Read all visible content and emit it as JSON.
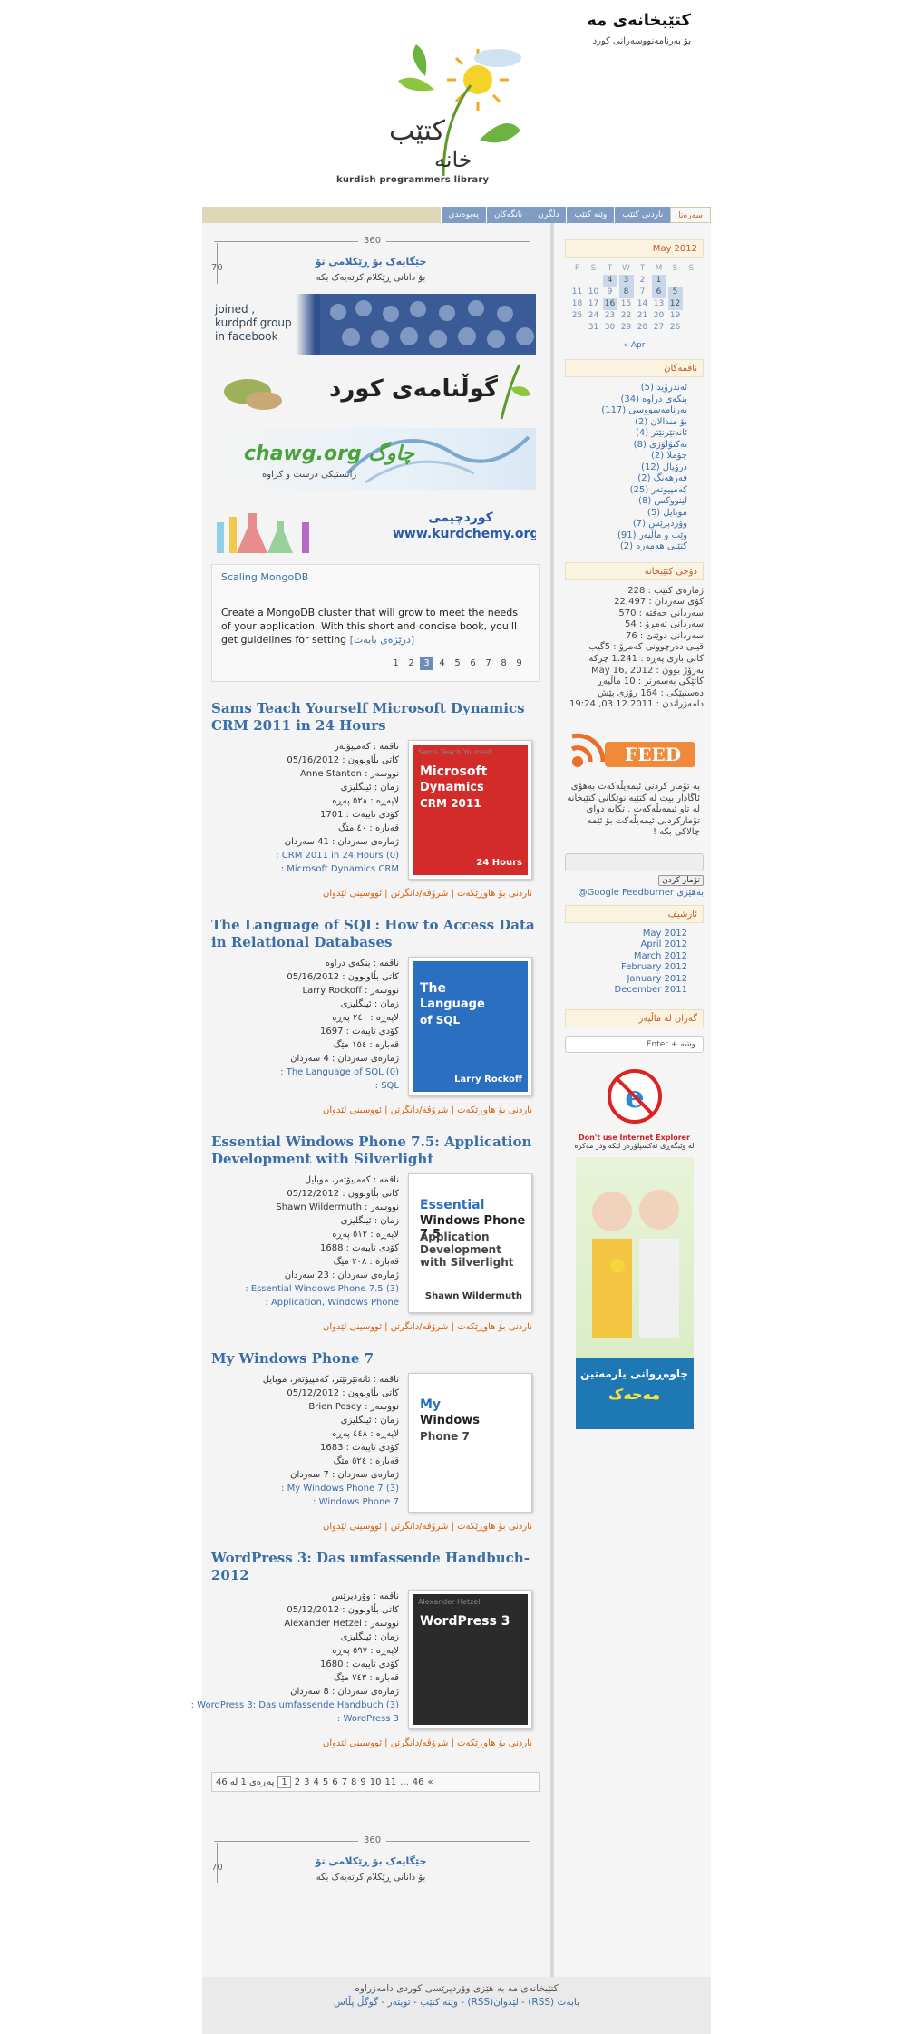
{
  "header": {
    "site_title": "کتێبخانەی مە",
    "tagline": "بۆ بەرنامەنووسەرانی کورد",
    "logo_caption": "kurdish programmers library"
  },
  "nav": [
    "سەرەتا",
    "ناردنی کتێب",
    "وێنە کتێب",
    "دڵگرن",
    "ناتگەکان",
    "پەیوەندی"
  ],
  "ad": {
    "width": "360",
    "height": "70",
    "title": "جێگایەک بۆ ڕێکلامی تۆ",
    "subtitle": "بۆ دانانی ڕێکلام کرتەیەک بکە"
  },
  "banners": {
    "facebook": "joined , kurdpdf group in facebook",
    "gul": "گوڵنامەی کورد",
    "chawg": "chawg.org چاوگ",
    "chawg_sub": "زانستیکی درست و کراوە",
    "kurdchemy": "کوردچیمی www.kurdchemy.org"
  },
  "featured": {
    "title": "Scaling MongoDB",
    "text": "Create a MongoDB cluster that will grow to meet the needs of your application. With this short and concise book, you'll get guidelines for setting",
    "more": "[درێژەی بابەت]",
    "pages": [
      "1",
      "2",
      "3",
      "4",
      "5",
      "6",
      "7",
      "8",
      "9"
    ],
    "current": "3"
  },
  "posts": [
    {
      "title": "Sams Teach Yourself Microsoft Dynamics CRM 2011 in 24 Hours",
      "meta": [
        "ناقمە : کەمپیۆتەر",
        "کاتی بڵاوبوون : 05/16/2012",
        "نووسەر : Anne Stanton",
        "زمان : ئینگلیزی",
        "لاپەڕە : ٥٢٨ پەڕە",
        "کۆدی تایبەت : 1701",
        "قەبارە : ٤٠ مێگ",
        "ژمارەی سەردان : 41 سەردان"
      ],
      "links": [
        "CRM 2011 in 24 Hours (0) :",
        "Microsoft Dynamics CRM :"
      ],
      "footer": "ناردنی بۆ هاوڕێکەت | شرۆڤە/دانگرتن | ئووسینی لێدوان",
      "cover": {
        "brand": "Sams Teach Yourself",
        "line1": "Microsoft",
        "line2": "Dynamics",
        "line3": "CRM 2011",
        "accent": "24 Hours",
        "color": "#d32a2a"
      }
    },
    {
      "title": "The Language of SQL: How to Access Data in Relational Databases",
      "meta": [
        "ناقمە : بنکەی دراوە",
        "کاتی بڵاوبوون : 05/16/2012",
        "نووسەر : Larry Rockoff",
        "زمان : ئینگلیزی",
        "لاپەڕە : ٢٤٠ پەڕە",
        "کۆدی تایبەت : 1697",
        "قەبارە : ١٥٤ مێگ",
        "ژمارەی سەردان : 4 سەردان"
      ],
      "links": [
        "The Language of SQL (0) :",
        "SQL :"
      ],
      "footer": "ناردنی بۆ هاوڕێکەت | شرۆڤە/دانگرتن | ئووسینی لێدوان",
      "cover": {
        "brand": "",
        "line1": "The",
        "line2": "Language",
        "line3": "of SQL",
        "accent": "Larry Rockoff",
        "color": "#2a6fc0"
      }
    },
    {
      "title": "Essential Windows Phone 7.5: Application Development with Silverlight",
      "meta": [
        "ناقمە : کەمپیۆتەر، موبایل",
        "کاتی بڵاوبوون : 05/12/2012",
        "نووسەر : Shawn Wildermuth",
        "زمان : ئینگلیزی",
        "لاپەڕە : ٥١٢ پەڕە",
        "کۆدی تایبەت : 1688",
        "قەبارە : ٢٠٨ مێگ",
        "ژمارەی سەردان : 23 سەردان"
      ],
      "links": [
        "Essential Windows Phone 7.5 (3) :",
        "Application, Windows Phone :"
      ],
      "footer": "ناردنی بۆ هاوڕێکەت | شرۆڤە/دانگرتن | ئووسینی لێدوان",
      "cover": {
        "brand": "",
        "line1": "Essential",
        "line2": "Windows Phone 7.5",
        "line3": "Application Development with Silverlight",
        "accent": "Shawn Wildermuth",
        "color": "#ffffff"
      }
    },
    {
      "title": "My Windows Phone 7",
      "meta": [
        "ناقمە : ئانەتێرنێتر، کەمپیۆتەر، موبایل",
        "کاتی بڵاوبوون : 05/12/2012",
        "نووسەر : Brien Posey",
        "زمان : ئینگلیزی",
        "لاپەڕە : ٤٤٨ پەڕە",
        "کۆدی تایبەت : 1683",
        "قەبارە : ٥٢٤ مێگ",
        "ژمارەی سەردان : 7 سەردان"
      ],
      "links": [
        "My Windows Phone 7 (3) :",
        "Windows Phone 7 :"
      ],
      "footer": "ناردنی بۆ هاوڕێکەت | شرۆڤە/دانگرتن | ئووسینی لێدوان",
      "cover": {
        "brand": "",
        "line1": "My",
        "line2": "Windows",
        "line3": "Phone 7",
        "accent": "",
        "color": "#ffffff"
      }
    },
    {
      "title": "WordPress 3: Das umfassende Handbuch-2012",
      "meta": [
        "ناقمە : وۆردپرێس",
        "کاتی بڵاوبوون : 05/12/2012",
        "نووسەر : Alexander Hetzel",
        "زمان : ئینگلیزی",
        "لاپەڕە : ٥٩٧ پەڕە",
        "کۆدی تایبەت : 1680",
        "قەبارە : ٧٤٣ مێگ",
        "ژمارەی سەردان : 8 سەردان"
      ],
      "links": [
        "WordPress 3: Das umfassende Handbuch (3) :",
        "WordPress 3 :"
      ],
      "footer": "ناردنی بۆ هاوڕێکەت | شرۆڤە/دانگرتن | ئووسینی لێدوان",
      "cover": {
        "brand": "Alexander Hetzel",
        "line1": "WordPress 3",
        "line2": "",
        "line3": "",
        "accent": "",
        "color": "#2b2b2b"
      }
    }
  ],
  "pager": {
    "label": "پەڕەی 1 لە 46",
    "items": [
      "1",
      "2",
      "3",
      "4",
      "5",
      "6",
      "7",
      "8",
      "9",
      "10",
      "11",
      "...",
      "46",
      "»"
    ],
    "current": "1"
  },
  "ad_bottom": {
    "width": "360",
    "height": "70",
    "title": "جێگایەک بۆ ڕێکلامی تۆ",
    "subtitle": "بۆ دانانی ڕێکلام کرتەیەک بکە"
  },
  "sidebar": {
    "calendar_title": "May 2012",
    "weekdays": [
      "F",
      "S",
      "T",
      "W",
      "T",
      "M",
      "S",
      "S"
    ],
    "weeks": [
      [
        "",
        "",
        "4",
        "3",
        "2",
        "1",
        "",
        ""
      ],
      [
        "11",
        "10",
        "9",
        "8",
        "7",
        "6",
        "5",
        ""
      ],
      [
        "18",
        "17",
        "16",
        "15",
        "14",
        "13",
        "12",
        ""
      ],
      [
        "25",
        "24",
        "23",
        "22",
        "21",
        "20",
        "19",
        ""
      ],
      [
        "",
        "31",
        "30",
        "29",
        "28",
        "27",
        "26",
        ""
      ]
    ],
    "calendar_nav": "Apr »",
    "categories_title": "ناقمەکان",
    "categories": [
      "ئەندرۆید (5)",
      "بنکەی دراوە (34)",
      "بەرنامەسووسی (117)",
      "بۆ مندالان (2)",
      "ئانەتێرنێتر (4)",
      "تەکنۆلۆژی (8)",
      "جۆملا (2)",
      "درۆپال (12)",
      "فەرهەنگ (2)",
      "کەمپیوتەر (25)",
      "لینووکس (8)",
      "موبایل (5)",
      "وۆردپرێس (7)",
      "وێب و ماڵپەر (91)",
      "کتێبی هەمەرە (2)"
    ],
    "stats_title": "دۆخی کتێبخانە",
    "stats": [
      "ژمارەی کتێب : 228",
      "کۆی سەردان : 22,497",
      "سەردانی حەفتە : 570",
      "سەردانی ئەمڕۆ : 54",
      "سەردانی دوێنێ : 76",
      "قیبی دەرچوونی کەمرۆ : 5گیب",
      "کاتی باری پەڕە : 1.241 چرکە",
      "بەرۆژ بوون : May 16, 2012",
      "کاتێکی بەسەرنر : 10 ماڵپەڕ",
      "دەستپێکی : 164 رۆژی پێش",
      "دامەزراندن : 03.12.2011, 19:24"
    ],
    "feed_label": "FEED",
    "feed_text": "بە تۆمار کردنی ئیمەیڵەکەت بەهۆی ئاگادار بیت لە کتێبە نوێکانی کتێبخانە لە تاو ئیمەیڵەکەت . تکایە دوای تۆمارکردنی ئیمەیڵەکت بۆ ئێمە چالاکی بکە !",
    "subscribe_button": "تۆمار کردن",
    "subscribe_note": "بەهێزی Google Feedburner@",
    "archive_title": "ئارشیف",
    "archive": [
      "May 2012",
      "April 2012",
      "March 2012",
      "February 2012",
      "January 2012",
      "December 2011"
    ],
    "search_title": "گەران لە ماڵپەر",
    "search_placeholder": "وشە + Enter",
    "ie_note": "Don't use Internet Explorer",
    "ie_sub": "لە وێبگەڕی ئەکسپلۆرەر لێکە ودر مەکرە",
    "charity": "چاوەڕوانی یارمەتین",
    "charity_sub": "مەحەک"
  },
  "footer": {
    "line1": "کتێبخانەی مە بە هێزی وۆردپرێسی کوردی دامەزراوە",
    "line2": "بابەت (RSS) - لێدوان(RSS) - وێنە کتێب - تویتەر - گوگڵ پڵاس"
  },
  "colors": {
    "accent": "#3a6ea8",
    "nav": "#7e9cc4",
    "orange": "#d4600a",
    "heading": "#c6582a"
  }
}
